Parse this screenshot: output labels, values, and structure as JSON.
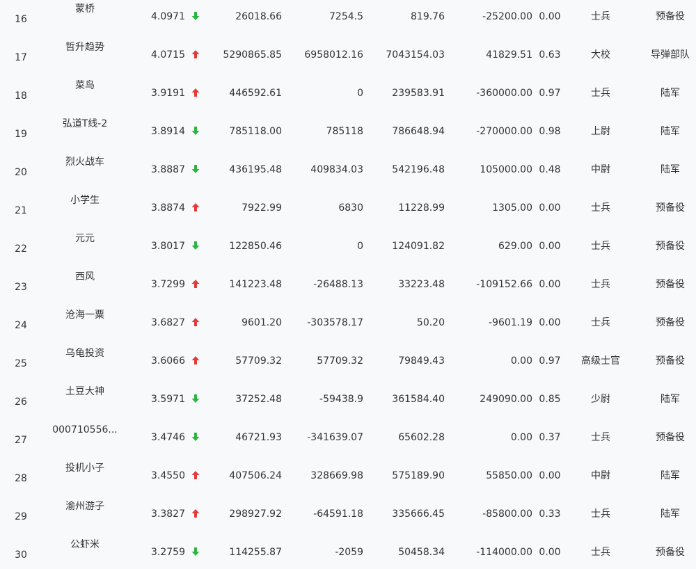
{
  "colors": {
    "up": "#e33b3b",
    "down": "#2db541",
    "text": "#333333",
    "background": "#f8f9fb"
  },
  "rows": [
    {
      "rank": "16",
      "name": "蒙桥",
      "score": "4.0971",
      "trend": "down",
      "v1": "26018.66",
      "v2": "7254.5",
      "v3": "819.76",
      "v4": "-25200.00",
      "v5": "0.00",
      "title": "士兵",
      "branch": "预备役"
    },
    {
      "rank": "17",
      "name": "哲升趋势",
      "score": "4.0715",
      "trend": "up",
      "v1": "5290865.85",
      "v2": "6958012.16",
      "v3": "7043154.03",
      "v4": "41829.51",
      "v5": "0.63",
      "title": "大校",
      "branch": "导弹部队"
    },
    {
      "rank": "18",
      "name": "菜鸟",
      "score": "3.9191",
      "trend": "up",
      "v1": "446592.61",
      "v2": "0",
      "v3": "239583.91",
      "v4": "-360000.00",
      "v5": "0.97",
      "title": "士兵",
      "branch": "陆军"
    },
    {
      "rank": "19",
      "name": "弘道T线-2",
      "score": "3.8914",
      "trend": "down",
      "v1": "785118.00",
      "v2": "785118",
      "v3": "786648.94",
      "v4": "-270000.00",
      "v5": "0.98",
      "title": "上尉",
      "branch": "陆军"
    },
    {
      "rank": "20",
      "name": "烈火战车",
      "score": "3.8887",
      "trend": "down",
      "v1": "436195.48",
      "v2": "409834.03",
      "v3": "542196.48",
      "v4": "105000.00",
      "v5": "0.48",
      "title": "中尉",
      "branch": "陆军"
    },
    {
      "rank": "21",
      "name": "小学生",
      "score": "3.8874",
      "trend": "up",
      "v1": "7922.99",
      "v2": "6830",
      "v3": "11228.99",
      "v4": "1305.00",
      "v5": "0.00",
      "title": "士兵",
      "branch": "预备役"
    },
    {
      "rank": "22",
      "name": "元元",
      "score": "3.8017",
      "trend": "down",
      "v1": "122850.46",
      "v2": "0",
      "v3": "124091.82",
      "v4": "629.00",
      "v5": "0.00",
      "title": "士兵",
      "branch": "预备役"
    },
    {
      "rank": "23",
      "name": "西风",
      "score": "3.7299",
      "trend": "up",
      "v1": "141223.48",
      "v2": "-26488.13",
      "v3": "33223.48",
      "v4": "-109152.66",
      "v5": "0.00",
      "title": "士兵",
      "branch": "预备役"
    },
    {
      "rank": "24",
      "name": "沧海一粟",
      "score": "3.6827",
      "trend": "up",
      "v1": "9601.20",
      "v2": "-303578.17",
      "v3": "50.20",
      "v4": "-9601.19",
      "v5": "0.00",
      "title": "士兵",
      "branch": "预备役"
    },
    {
      "rank": "25",
      "name": "乌龟投资",
      "score": "3.6066",
      "trend": "up",
      "v1": "57709.32",
      "v2": "57709.32",
      "v3": "79849.43",
      "v4": "0.00",
      "v5": "0.97",
      "title": "高级士官",
      "branch": "预备役"
    },
    {
      "rank": "26",
      "name": "土豆大神",
      "score": "3.5971",
      "trend": "down",
      "v1": "37252.48",
      "v2": "-59438.9",
      "v3": "361584.40",
      "v4": "249090.00",
      "v5": "0.85",
      "title": "少尉",
      "branch": "陆军"
    },
    {
      "rank": "27",
      "name": "000710556...",
      "score": "3.4746",
      "trend": "down",
      "v1": "46721.93",
      "v2": "-341639.07",
      "v3": "65602.28",
      "v4": "0.00",
      "v5": "0.37",
      "title": "士兵",
      "branch": "预备役"
    },
    {
      "rank": "28",
      "name": "投机小子",
      "score": "3.4550",
      "trend": "up",
      "v1": "407506.24",
      "v2": "328669.98",
      "v3": "575189.90",
      "v4": "55850.00",
      "v5": "0.00",
      "title": "中尉",
      "branch": "陆军"
    },
    {
      "rank": "29",
      "name": "渝州游子",
      "score": "3.3827",
      "trend": "up",
      "v1": "298927.92",
      "v2": "-64591.18",
      "v3": "335666.45",
      "v4": "-85800.00",
      "v5": "0.33",
      "title": "士兵",
      "branch": "陆军"
    },
    {
      "rank": "30",
      "name": "公虾米",
      "score": "3.2759",
      "trend": "down",
      "v1": "114255.87",
      "v2": "-2059",
      "v3": "50458.34",
      "v4": "-114000.00",
      "v5": "0.00",
      "title": "士兵",
      "branch": "预备役"
    }
  ]
}
